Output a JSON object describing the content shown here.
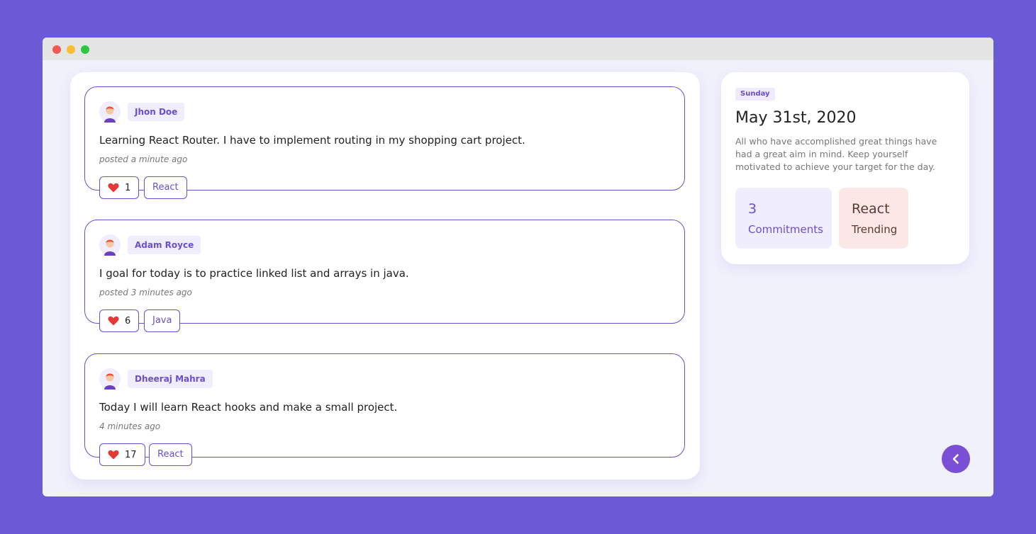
{
  "posts": [
    {
      "author": "Jhon Doe",
      "text": "Learning React Router. I have to implement routing in my shopping cart project.",
      "posted": "posted a minute ago",
      "likes": "1",
      "tag": "React"
    },
    {
      "author": "Adam Royce",
      "text": "I goal for today is to practice linked list and arrays in java.",
      "posted": "posted 3 minutes ago",
      "likes": "6",
      "tag": "Java"
    },
    {
      "author": "Dheeraj Mahra",
      "text": "Today I will learn React hooks and make a small project.",
      "posted": "4 minutes ago",
      "likes": "17",
      "tag": "React"
    }
  ],
  "sidebar": {
    "day": "Sunday",
    "date": "May 31st, 2020",
    "quote": "All who have accomplished great things have had a great aim in mind. Keep yourself motivated to achieve your target for the day.",
    "commitments": {
      "value": "3",
      "label": "Commitments"
    },
    "trending": {
      "value": "React",
      "label": "Trending"
    }
  },
  "colors": {
    "background": "#6a5ad5",
    "accent": "#6b4fcf",
    "heart": "#e53935"
  },
  "icons": {
    "back": "chevron-left-icon",
    "like": "heart-icon",
    "avatar": "avatar"
  }
}
